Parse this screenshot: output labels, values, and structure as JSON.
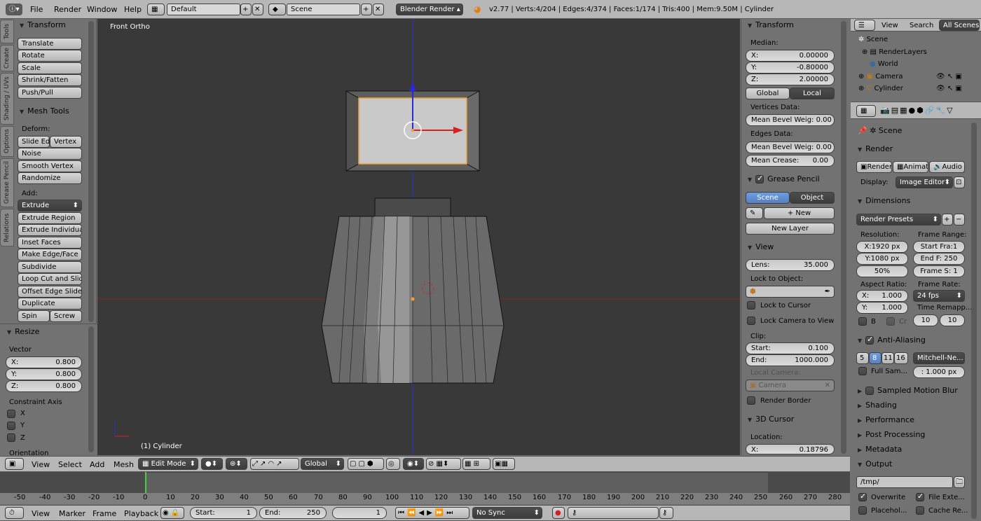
{
  "topbar": {
    "menus": [
      "File",
      "Render",
      "Window",
      "Help"
    ],
    "layout": "Default",
    "scene": "Scene",
    "engine": "Blender Render",
    "stats": "v2.77 | Verts:4/204 | Edges:4/374 | Faces:1/174 | Tris:400 | Mem:9.50M | Cylinder"
  },
  "vtabs": [
    "Tools",
    "Create",
    "Shading / UVs",
    "Options",
    "Grease Pencil",
    "Relations"
  ],
  "tools": {
    "transform_title": "Transform",
    "transform": [
      "Translate",
      "Rotate",
      "Scale",
      "Shrink/Fatten",
      "Push/Pull"
    ],
    "mesh_title": "Mesh Tools",
    "deform_label": "Deform:",
    "slide_edge": "Slide Ed",
    "vertex": "Vertex",
    "noise": "Noise",
    "smooth": "Smooth Vertex",
    "randomize": "Randomize",
    "add_label": "Add:",
    "extrude": "Extrude",
    "add_items": [
      "Extrude Region",
      "Extrude Individual",
      "Inset Faces",
      "Make Edge/Face",
      "Subdivide",
      "Loop Cut and Slide",
      "Offset Edge Slide",
      "Duplicate"
    ],
    "spin": "Spin",
    "screw": "Screw"
  },
  "resize": {
    "title": "Resize",
    "vector_label": "Vector",
    "x": "X:",
    "xv": "0.800",
    "y": "Y:",
    "yv": "0.800",
    "z": "Z:",
    "zv": "0.800",
    "constraint_label": "Constraint Axis",
    "cx": "X",
    "cy": "Y",
    "cz": "Z",
    "orientation": "Orientation"
  },
  "viewport": {
    "view_label": "Front Ortho",
    "object_label": "(1) Cylinder"
  },
  "npanel": {
    "transform_title": "Transform",
    "median": "Median:",
    "x": "X:",
    "xv": "0.00000",
    "y": "Y:",
    "yv": "-0.80000",
    "z": "Z:",
    "zv": "2.00000",
    "global": "Global",
    "local": "Local",
    "vertices_data": "Vertices Data:",
    "mean_bevel_v": "Mean Bevel Weig: 0.00",
    "edges_data": "Edges Data:",
    "mean_bevel_e": "Mean Bevel Weig: 0.00",
    "mean_crease": "Mean Crease:",
    "mean_crease_v": "0.00",
    "grease_title": "Grease Pencil",
    "scene": "Scene",
    "object": "Object",
    "new": "New",
    "new_layer": "New Layer",
    "view_title": "View",
    "lens": "Lens:",
    "lens_v": "35.000",
    "lock_obj": "Lock to Object:",
    "lock_cursor": "Lock to Cursor",
    "lock_camera": "Lock Camera to View",
    "clip": "Clip:",
    "start": "Start:",
    "start_v": "0.100",
    "end": "End:",
    "end_v": "1000.000",
    "local_camera": "Local Camera:",
    "camera": "Camera",
    "render_border": "Render Border",
    "cursor_title": "3D Cursor",
    "location": "Location:",
    "cx": "X:",
    "cxv": "0.18796"
  },
  "outliner": {
    "view": "View",
    "search": "Search",
    "all_scenes": "All Scenes",
    "items": [
      "Scene",
      "RenderLayers",
      "World",
      "Camera",
      "Cylinder"
    ]
  },
  "props": {
    "scene": "Scene",
    "render_title": "Render",
    "render_btn": "Render",
    "anim_btn": "Animati",
    "audio_btn": "Audio",
    "display_label": "Display:",
    "display_value": "Image Editor",
    "dimensions_title": "Dimensions",
    "presets": "Render Presets",
    "resolution": "Resolution:",
    "frame_range": "Frame Range:",
    "resx": "X:1920 px",
    "resy": "Y:1080 px",
    "respct": "50%",
    "start_frame": "Start Fra:1",
    "end_frame": "End F: 250",
    "frame_step": "Frame S: 1",
    "aspect": "Aspect Ratio:",
    "framerate": "Frame Rate:",
    "ax": "X:",
    "axv": "1.000",
    "ay": "Y:",
    "ayv": "1.000",
    "fps": "24 fps",
    "time_remap": "Time Remapp...",
    "tr1": "10",
    "tr2": "10",
    "b": "B",
    "cr": "Cr",
    "aa_title": "Anti-Aliasing",
    "aa_samples": [
      "5",
      "8",
      "11",
      "16"
    ],
    "aa_filter": "Mitchell-Ne...",
    "full_sample": "Full Sam...",
    "filter_size": ": 1.000 px",
    "motion_blur": "Sampled Motion Blur",
    "shading": "Shading",
    "performance": "Performance",
    "post": "Post Processing",
    "metadata": "Metadata",
    "output": "Output",
    "output_path": "/tmp/",
    "overwrite": "Overwrite",
    "file_ext": "File Exte...",
    "placeholders": "Placehol...",
    "cache": "Cache Re..."
  },
  "vp_header": {
    "view": "View",
    "select": "Select",
    "add": "Add",
    "mesh": "Mesh",
    "mode": "Edit Mode",
    "orientation": "Global"
  },
  "timeline": {
    "ticks": [
      "-50",
      "-40",
      "-30",
      "-20",
      "-10",
      "0",
      "10",
      "20",
      "30",
      "40",
      "50",
      "60",
      "70",
      "80",
      "90",
      "100",
      "110",
      "120",
      "130",
      "140",
      "150",
      "160",
      "170",
      "180",
      "190",
      "200",
      "210",
      "220",
      "230",
      "240",
      "250",
      "260",
      "270",
      "280"
    ],
    "view": "View",
    "marker": "Marker",
    "frame": "Frame",
    "playback": "Playback",
    "start": "Start:",
    "start_v": "1",
    "end": "End:",
    "end_v": "250",
    "current": "1",
    "sync": "No Sync"
  }
}
